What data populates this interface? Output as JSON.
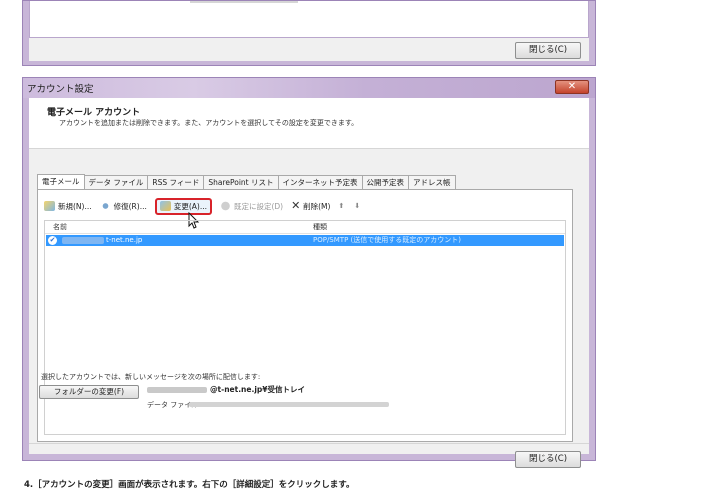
{
  "prev_window": {
    "close_label": "閉じる(C)"
  },
  "dialog": {
    "title": "アカウント設定",
    "close_glyph": "✕",
    "header_title": "電子メール アカウント",
    "header_desc": "アカウントを追加または削除できます。また、アカウントを選択してその設定を変更できます。",
    "tabs": [
      "電子メール",
      "データ ファイル",
      "RSS フィード",
      "SharePoint リスト",
      "インターネット予定表",
      "公開予定表",
      "アドレス帳"
    ],
    "toolbar": {
      "new_label": "新規(N)...",
      "repair_label": "修復(R)...",
      "change_label": "変更(A)...",
      "set_default_label": "既定に設定(D)",
      "delete_label": "削除(M)",
      "up_glyph": "⬆",
      "down_glyph": "⬇"
    },
    "list": {
      "col_name": "名前",
      "col_type": "種類",
      "rows": [
        {
          "check": "✔",
          "account": "t-net.ne.jp",
          "type": "POP/SMTP (送信で使用する既定のアカウント)"
        }
      ]
    },
    "deliver_label": "選択したアカウントでは、新しいメッセージを次の場所に配信します:",
    "folder_button": "フォルダーの変更(F)",
    "deliver_path": "@t-net.ne.jp¥受信トレイ",
    "data_file_label": "データ ファイル: C:¥",
    "close_label": "閉じる(C)"
  },
  "caption": "4.［アカウントの変更］画面が表示されます。右下の［詳細設定］をクリックします。"
}
